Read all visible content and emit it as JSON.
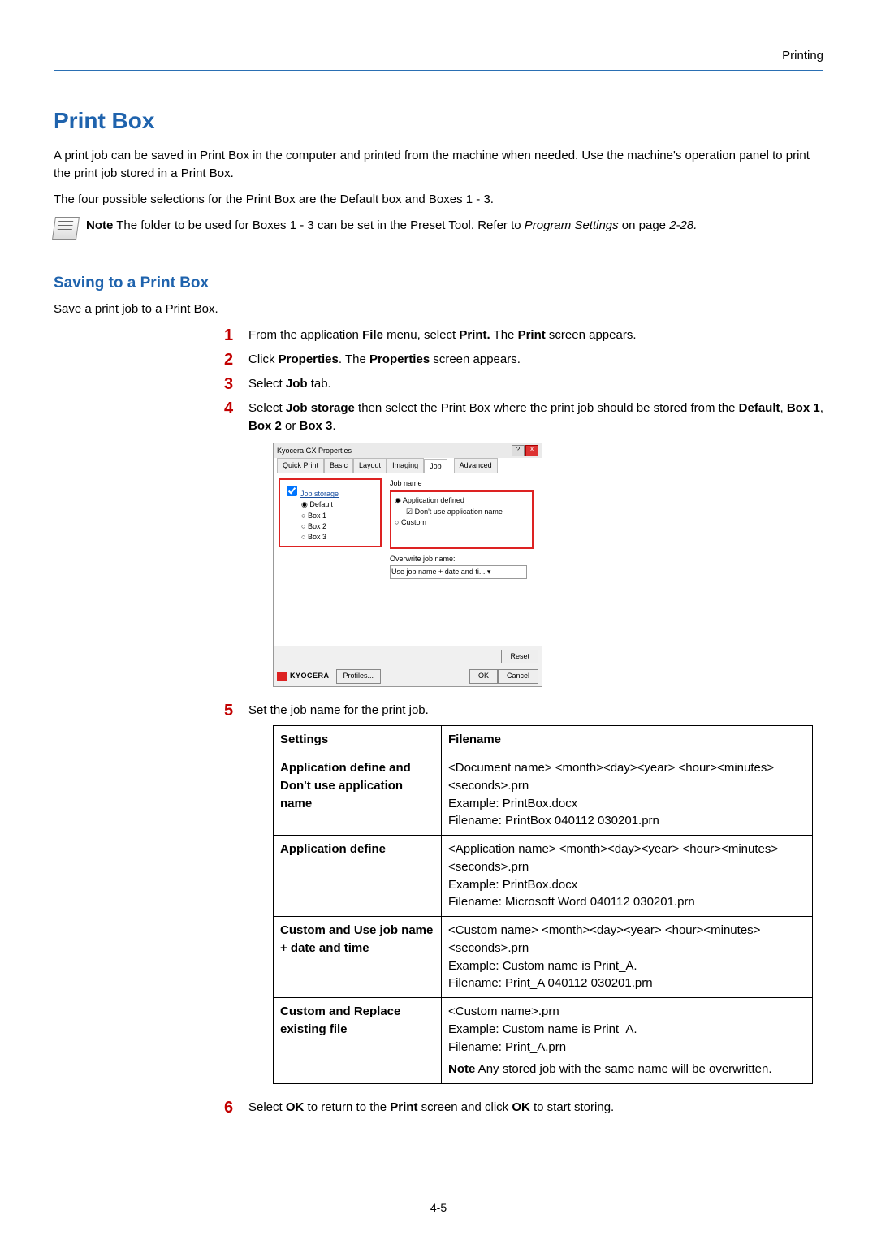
{
  "header_label": "Printing",
  "h1": "Print Box",
  "intro1": "A print job can be saved in Print Box in the computer and printed from the machine when needed. Use the machine's operation panel to print the print job stored in a Print Box.",
  "intro2": "The four possible selections for the Print Box are the Default box and Boxes 1 - 3.",
  "note_label": "Note",
  "note_text": "  The folder to be used for Boxes 1 - 3 can be set in the Preset Tool. Refer to ",
  "note_ref": "Program Settings",
  "note_tail": " on page ",
  "note_page": "2-28.",
  "h2": "Saving to a Print Box",
  "lead2": "Save a print job to a Print Box.",
  "steps": {
    "s1a": "From the application ",
    "s1b": "File",
    "s1c": " menu, select ",
    "s1d": "Print.",
    "s1e": " The ",
    "s1f": "Print",
    "s1g": " screen appears.",
    "s2a": "Click ",
    "s2b": "Properties",
    "s2c": ". The ",
    "s2d": "Properties",
    "s2e": " screen appears.",
    "s3a": "Select ",
    "s3b": "Job",
    "s3c": " tab.",
    "s4a": "Select ",
    "s4b": "Job storage",
    "s4c": " then select the Print Box where the print job should be stored from the ",
    "s4d": "Default",
    "s4e": ", ",
    "s4f": "Box 1",
    "s4g": ", ",
    "s4h": "Box 2",
    "s4i": " or ",
    "s4j": "Box 3",
    "s4k": ".",
    "s5": "Set the job name for the print job.",
    "s6a": "Select ",
    "s6b": "OK",
    "s6c": " to return to the ",
    "s6d": "Print",
    "s6e": " screen and click ",
    "s6f": "OK",
    "s6g": " to start storing."
  },
  "dialog": {
    "title": "Kyocera                                   GX Properties",
    "tabs": [
      "Quick Print",
      "Basic",
      "Layout",
      "Imaging",
      "Job",
      "Advanced"
    ],
    "job_storage": "Job storage",
    "options": [
      "Default",
      "Box 1",
      "Box 2",
      "Box 3"
    ],
    "jobname_label": "Job name",
    "app_defined": "Application defined",
    "dont_use_app": "Don't use application name",
    "custom": "Custom",
    "overwrite": "Overwrite job name:",
    "overwrite_sel": "Use job name + date and ti...",
    "reset": "Reset",
    "brand": "KYOCERA",
    "profiles": "Profiles...",
    "ok": "OK",
    "cancel": "Cancel"
  },
  "table": {
    "h1": "Settings",
    "h2": "Filename",
    "r1c1": "Application define and Don't use application name",
    "r1c2": "<Document name> <month><day><year> <hour><minutes><seconds>.prn\nExample: PrintBox.docx\nFilename: PrintBox 040112 030201.prn",
    "r2c1": "Application define",
    "r2c2": "<Application name> <month><day><year> <hour><minutes><seconds>.prn\nExample: PrintBox.docx\nFilename: Microsoft Word 040112 030201.prn",
    "r3c1": "Custom and Use job name + date and time",
    "r3c2": "<Custom name> <month><day><year> <hour><minutes><seconds>.prn\nExample: Custom name is Print_A.\nFilename: Print_A 040112 030201.prn",
    "r4c1": "Custom and Replace existing file",
    "r4c2_a": "<Custom name>.prn\nExample: Custom name is Print_A.\nFilename: Print_A.prn",
    "r4c2_note_label": "Note",
    "r4c2_note": "  Any stored job with the same name will be overwritten."
  },
  "page_num": "4-5"
}
